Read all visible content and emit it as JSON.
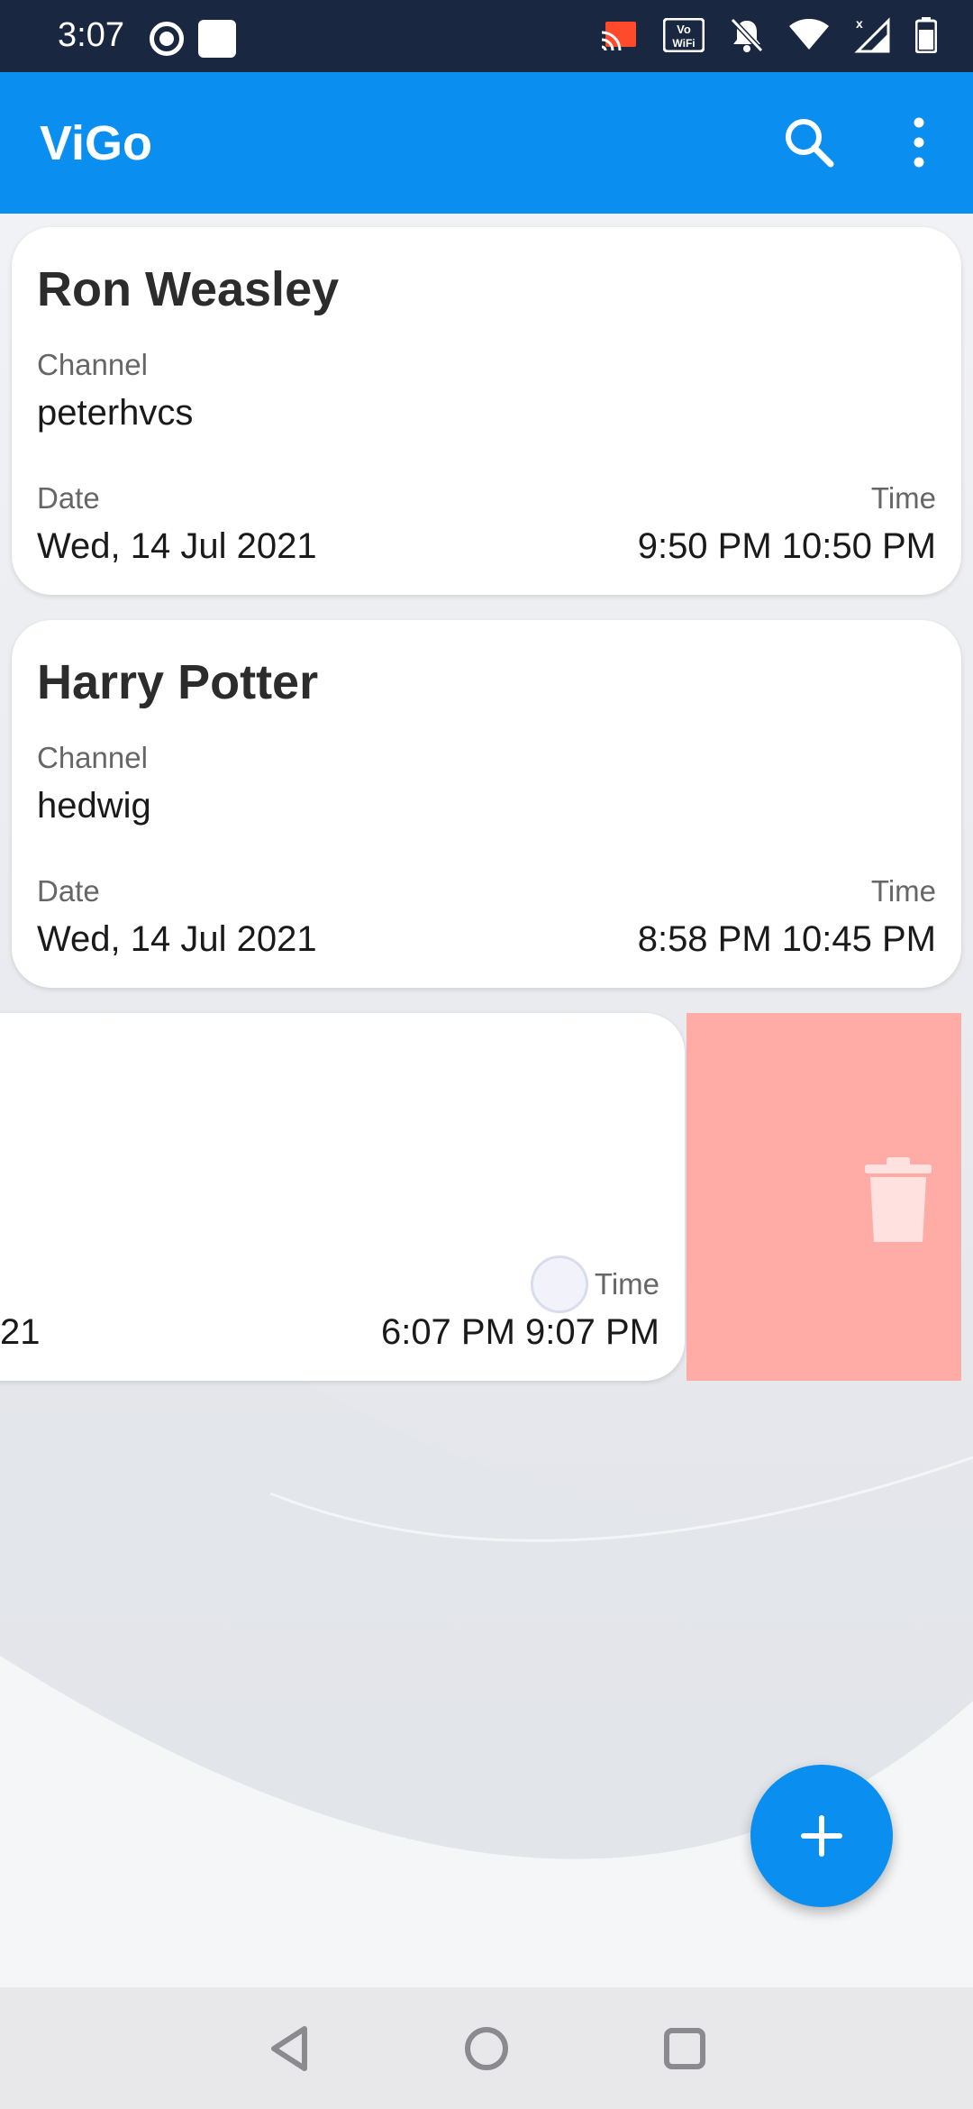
{
  "status_bar": {
    "time": "3:07",
    "icons": [
      "record-icon",
      "notification-square-icon",
      "cast-icon",
      "vowifi-icon",
      "bell-off-icon",
      "wifi-icon",
      "signal-icon",
      "battery-icon"
    ],
    "vowifi_text": "VoWiFi"
  },
  "app_bar": {
    "title": "ViGo",
    "search_icon": "search-icon",
    "more_icon": "more-vert-icon",
    "color": "#0a8ff0"
  },
  "cards": [
    {
      "name": "Ron Weasley",
      "channel_label": "Channel",
      "channel": "peterhvcs",
      "date_label": "Date",
      "date": "Wed, 14 Jul 2021",
      "time_label": "Time",
      "time": "9:50 PM 10:50 PM"
    },
    {
      "name": "Harry Potter",
      "channel_label": "Channel",
      "channel": "hedwig",
      "date_label": "Date",
      "date": "Wed, 14 Jul 2021",
      "time_label": "Time",
      "time": "8:58 PM 10:45 PM"
    },
    {
      "date_partial": "21",
      "time_label": "Time",
      "time": "6:07 PM 9:07 PM",
      "swipe_action": "delete",
      "swipe_icon": "trash-icon",
      "swipe_color": "#ffaca6"
    }
  ],
  "fab": {
    "icon": "plus-icon"
  },
  "nav_bar": {
    "icons": [
      "back-icon",
      "home-icon",
      "recents-icon"
    ]
  }
}
